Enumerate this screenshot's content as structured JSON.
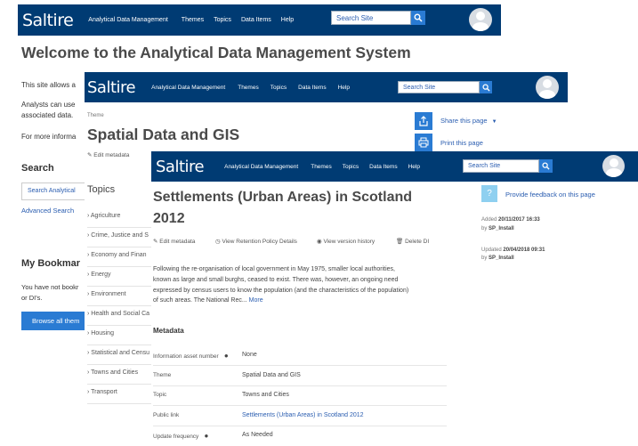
{
  "site": {
    "logo": "Saltire",
    "nav": [
      "Analytical Data Management",
      "Themes",
      "Topics",
      "Data Items",
      "Help"
    ],
    "search_placeholder": "Search Site"
  },
  "layer1": {
    "title": "Welcome to the Analytical Data Management System",
    "para1": "This site allows a",
    "para2a": "Analysts can use",
    "para2b": "associated data.",
    "para3": "For more informa",
    "search_heading": "Search",
    "search_input": "Search Analytical",
    "advanced_search": "Advanced Search",
    "bookmarks_heading": "My Bookmar",
    "bookmarks_text_a": "You have not bookr",
    "bookmarks_text_b": "or DI's.",
    "browse_button": "Browse all them"
  },
  "layer2": {
    "breadcrumb": "Theme",
    "title": "Spatial Data and GIS",
    "edit_metadata": "Edit metadata",
    "topics_heading": "Topics",
    "topics": [
      "Agriculture",
      "Crime, Justice and S",
      "Economy and Finan",
      "Energy",
      "Environment",
      "Health and Social Ca",
      "Housing",
      "Statistical and Censu",
      "Towns and Cities",
      "Transport"
    ],
    "share": "Share this page",
    "print": "Print this page"
  },
  "layer3": {
    "title_line1": "Settlements (Urban Areas) in Scotland",
    "title_line2": "2012",
    "actions": [
      "Edit metadata",
      "View Retention Policy Details",
      "View version history",
      "Delete DI"
    ],
    "description": [
      "Following the re-organisation of local government in May 1975, smaller local authorities,",
      "known as large and small burghs, ceased to exist. There was, however, an ongoing need",
      "expressed by census users to know the population (and the characteristics of the population)",
      "of such areas. The National Rec..."
    ],
    "more": "More",
    "metadata_heading": "Metadata",
    "metadata": [
      {
        "label": "Information asset number",
        "value": "None",
        "info": true,
        "link": false
      },
      {
        "label": "Theme",
        "value": "Spatial Data and GIS",
        "info": false,
        "link": false
      },
      {
        "label": "Topic",
        "value": "Towns and Cities",
        "info": false,
        "link": false
      },
      {
        "label": "Public link",
        "value": "Settlements (Urban Areas) in Scotland 2012",
        "info": false,
        "link": true
      },
      {
        "label": "Update frequency",
        "value": "As Needed",
        "info": true,
        "link": false
      }
    ],
    "feedback": "Provide feedback on this page",
    "added_label": "Added",
    "added_date": "20/11/2017 16:33",
    "added_by_prefix": "by",
    "added_by": "SP_Install",
    "updated_label": "Updated",
    "updated_date": "20/04/2018 09:31",
    "updated_by_prefix": "by",
    "updated_by": "SP_Install"
  },
  "colors": {
    "navbar": "#003b73",
    "link": "#2a5db0",
    "button": "#2a7bd3"
  }
}
